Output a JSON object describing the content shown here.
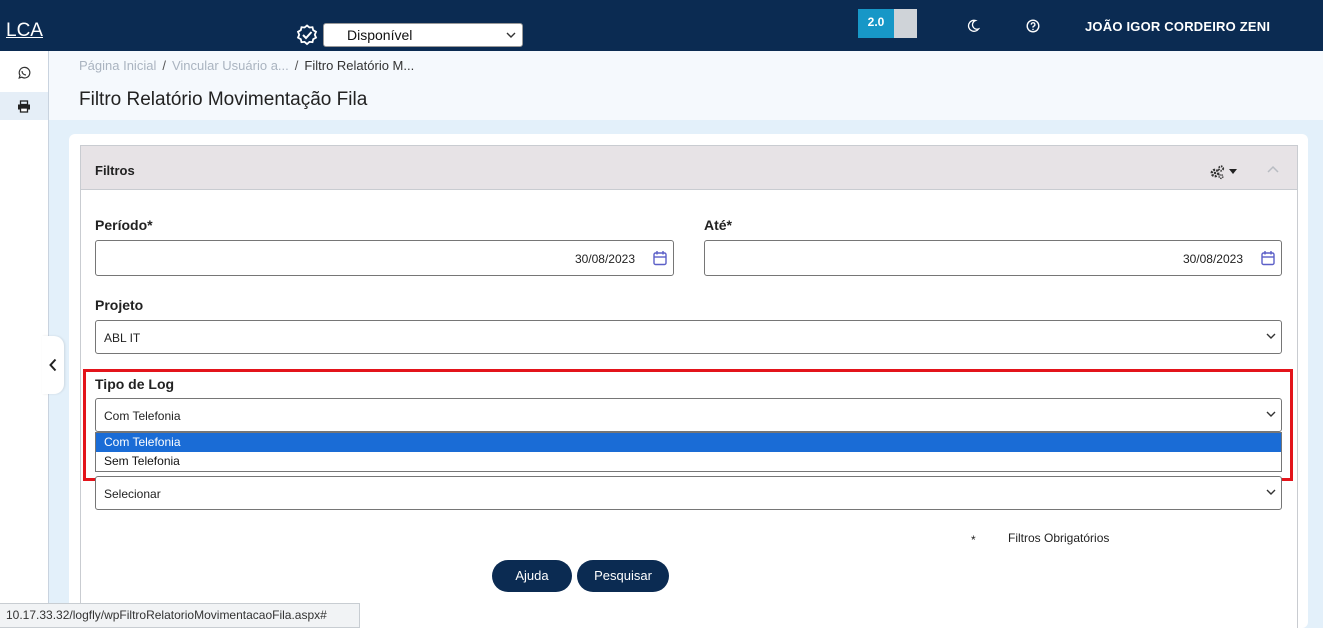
{
  "header": {
    "logo": "LCA",
    "status_value": "Disponível",
    "version": "2.0",
    "user_name": "JOÃO IGOR CORDEIRO ZENI"
  },
  "sidebar": {
    "items": [
      {
        "icon": "whatsapp-icon"
      },
      {
        "icon": "printer-icon"
      }
    ]
  },
  "breadcrumb": {
    "items": [
      "Página Inicial",
      "Vincular Usuário a...",
      "Filtro Relatório M..."
    ],
    "separator": "/"
  },
  "page": {
    "title": "Filtro Relatório Movimentação Fila"
  },
  "panel": {
    "title": "Filtros"
  },
  "form": {
    "periodo_label": "Período*",
    "periodo_value": "30/08/2023",
    "ate_label": "Até*",
    "ate_value": "30/08/2023",
    "projeto_label": "Projeto",
    "projeto_value": "ABL IT",
    "tipo_log_label": "Tipo de Log",
    "tipo_log_value": "Com Telefonia",
    "tipo_log_options": [
      "Com Telefonia",
      "Sem Telefonia"
    ],
    "fourth_select_value": "Selecionar",
    "required_star": "*",
    "required_text": "Filtros Obrigatórios"
  },
  "buttons": {
    "ajuda": "Ajuda",
    "pesquisar": "Pesquisar"
  },
  "status_bar": {
    "url": "10.17.33.32/logfly/wpFiltroRelatorioMovimentacaoFila.aspx#"
  },
  "colors": {
    "topbar": "#0b2b52",
    "accent_badge": "#1797c7",
    "highlight_border": "#e3141b",
    "selected_option": "#1a6cd6"
  }
}
